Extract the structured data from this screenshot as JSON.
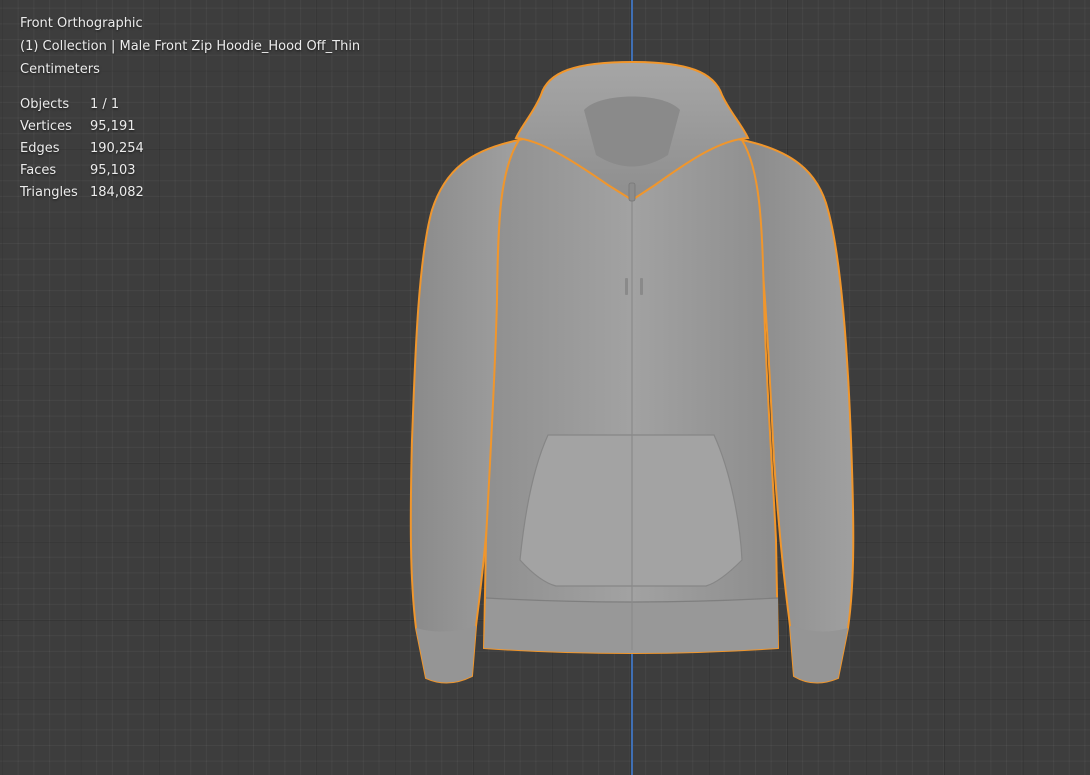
{
  "viewport": {
    "view_name": "Front Orthographic",
    "collection_label": "(1) Collection | Male Front Zip Hoodie_Hood Off_Thin",
    "units": "Centimeters"
  },
  "statistics": [
    {
      "label": "Objects",
      "value": "1 / 1"
    },
    {
      "label": "Vertices",
      "value": "95,191"
    },
    {
      "label": "Edges",
      "value": "190,254"
    },
    {
      "label": "Faces",
      "value": "95,103"
    },
    {
      "label": "Triangles",
      "value": "184,082"
    }
  ],
  "colors": {
    "background": "#3d3d3d",
    "selection_outline": "#f0962c",
    "axis_z": "#3f6fb4",
    "mesh": "#9c9c9c"
  },
  "model": {
    "icon": "hoodie-mesh",
    "selected": true
  }
}
